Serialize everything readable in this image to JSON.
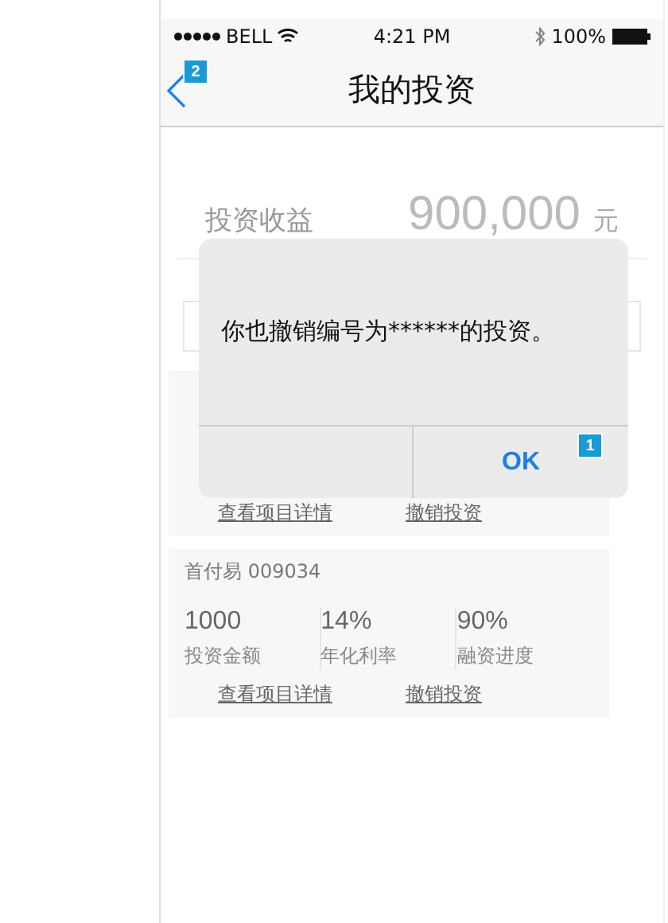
{
  "status_bar": {
    "carrier": "BELL",
    "time": "4:21 PM",
    "battery": "100%"
  },
  "nav": {
    "title": "我的投资",
    "badge": "2"
  },
  "summary": {
    "label": "投资收益",
    "amount": "900,000",
    "unit": "元"
  },
  "cards": [
    {
      "actions": [
        "查看项目详情",
        "撤销投资"
      ]
    },
    {
      "title": "首付易 009034",
      "stats": [
        {
          "value": "1000",
          "label": "投资金额"
        },
        {
          "value": "14%",
          "label": "年化利率"
        },
        {
          "value": "90%",
          "label": "融资进度"
        }
      ],
      "actions": [
        "查看项目详情",
        "撤销投资"
      ]
    }
  ],
  "dialog": {
    "message": "你也撤销编号为******的投资。",
    "buttons": [
      "OK"
    ],
    "badge": "1"
  }
}
